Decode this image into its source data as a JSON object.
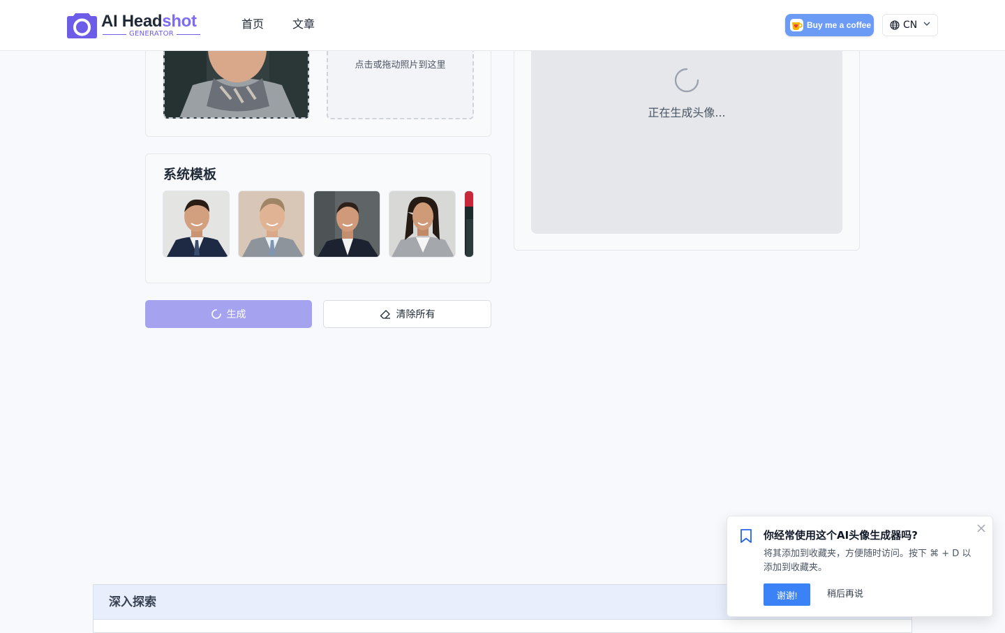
{
  "header": {
    "logo": {
      "text_main": "AI Head",
      "text_accent": "shot",
      "subtitle": "GENERATOR"
    },
    "nav": [
      {
        "label": "首页"
      },
      {
        "label": "文章"
      }
    ],
    "coffee_button": {
      "label": "Buy me a coffee",
      "icon": "coffee-cup-icon"
    },
    "language": {
      "code": "CN",
      "icon": "globe-icon"
    }
  },
  "upload": {
    "drop_zone_text": "点击或拖动照片到这里"
  },
  "templates": {
    "title": "系统模板",
    "items": [
      {
        "name": "template-man-navy-suit"
      },
      {
        "name": "template-man-grey-suit"
      },
      {
        "name": "template-man-dark-suit"
      },
      {
        "name": "template-woman-grey-blazer"
      },
      {
        "name": "template-partial"
      }
    ]
  },
  "actions": {
    "generate_label": "生成",
    "clear_label": "清除所有"
  },
  "result": {
    "status_text": "正在生成头像..."
  },
  "explore": {
    "title": "深入探索"
  },
  "bookmark_popup": {
    "title": "你经常使用这个AI头像生成器吗?",
    "description": "将其添加到收藏夹，方便随时访问。按下 ⌘ + D 以添加到收藏夹。",
    "ok_label": "谢谢!",
    "later_label": "稍后再说"
  },
  "colors": {
    "brand": "#6d5ce8",
    "generate_disabled": "#a5a3f0",
    "primary_blue": "#3b82f6",
    "coffee_blue": "#6b9bf5"
  }
}
